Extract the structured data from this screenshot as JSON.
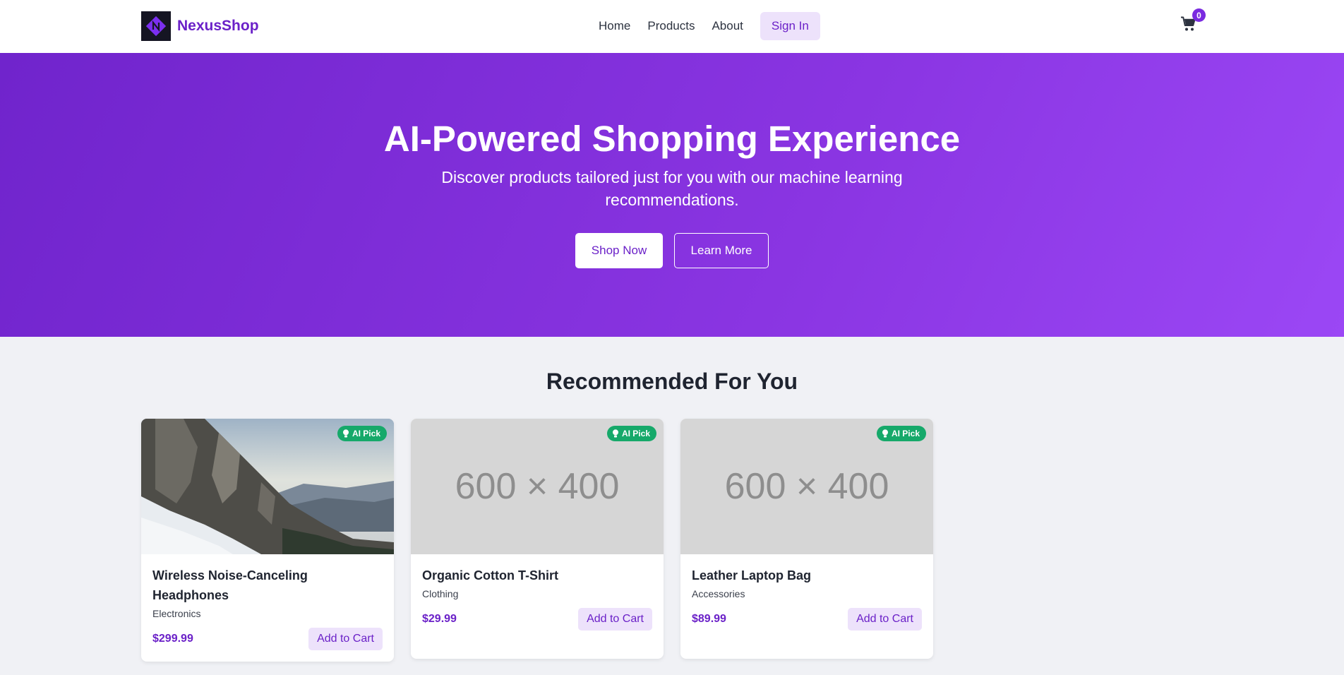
{
  "header": {
    "brand": "NexusShop",
    "nav": [
      {
        "label": "Home"
      },
      {
        "label": "Products"
      },
      {
        "label": "About"
      }
    ],
    "signin_label": "Sign In",
    "cart_count": "0",
    "cart_icon": "shopping-cart-icon",
    "logo_icon": "nexus-logo-icon"
  },
  "hero": {
    "title": "AI-Powered Shopping Experience",
    "subtitle": "Discover products tailored just for you with our machine learning recommendations.",
    "primary_label": "Shop Now",
    "secondary_label": "Learn More"
  },
  "recommendations": {
    "title": "Recommended For You",
    "badge_label": "AI Pick",
    "badge_icon": "lightbulb-icon",
    "add_label": "Add to Cart",
    "products": [
      {
        "name": "Wireless Noise-Canceling Headphones",
        "category": "Electronics",
        "price": "$299.99",
        "image": "photo-mountain"
      },
      {
        "name": "Organic Cotton T-Shirt",
        "category": "Clothing",
        "price": "$29.99",
        "image_text": "600 × 400"
      },
      {
        "name": "Leather Laptop Bag",
        "category": "Accessories",
        "price": "$89.99",
        "image_text": "600 × 400"
      }
    ]
  },
  "colors": {
    "brand": "#6b21c8",
    "hero_start": "#7024cc",
    "hero_end": "#9b47f5",
    "badge": "#16a96a",
    "page_bg": "#f0f1f5"
  }
}
